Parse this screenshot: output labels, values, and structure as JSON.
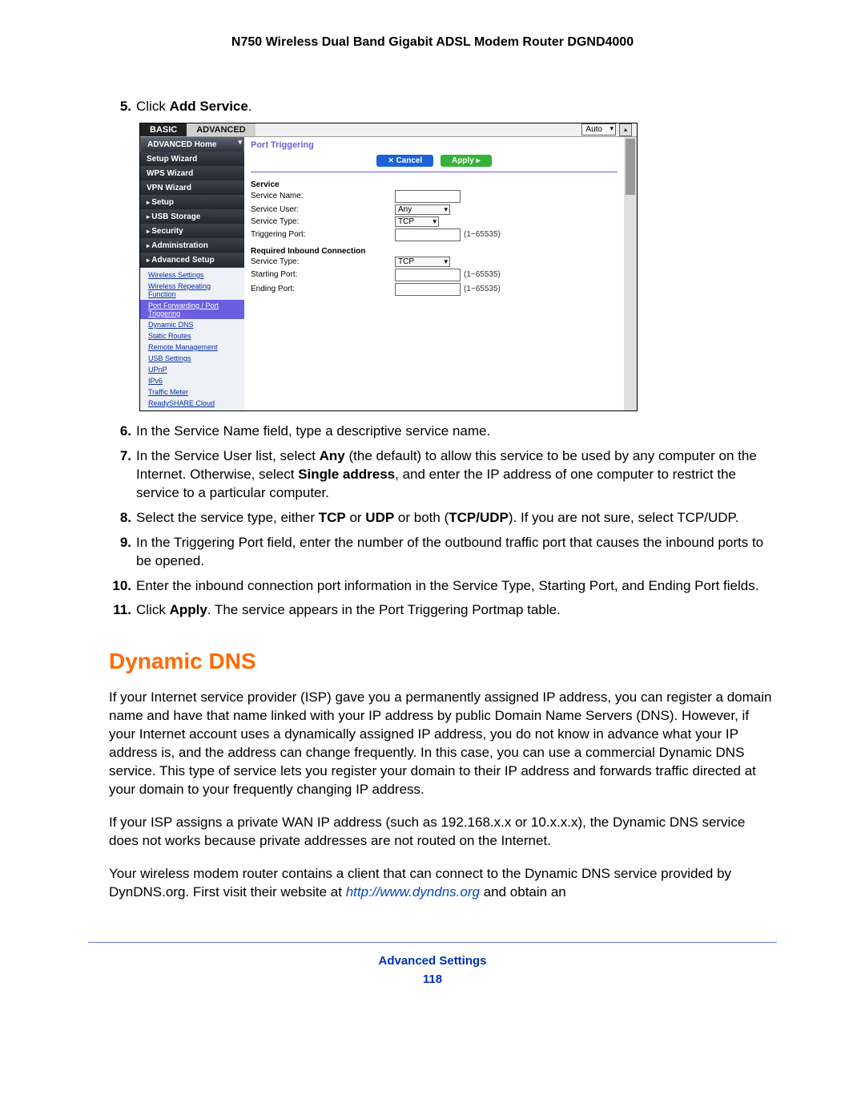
{
  "doc_title": "N750 Wireless Dual Band Gigabit ADSL Modem Router DGND4000",
  "footer_title": "Advanced Settings",
  "page_number": "118",
  "steps": {
    "s5_num": "5.",
    "s5_pre": "Click ",
    "s5_bold": "Add Service",
    "s5_post": ".",
    "s6_num": "6.",
    "s6": "In the Service Name field, type a descriptive service name.",
    "s7_num": "7.",
    "s7_a": "In the Service User list, select ",
    "s7_b": "Any",
    "s7_c": " (the default) to allow this service to be used by any computer on the Internet. Otherwise, select ",
    "s7_d": "Single address",
    "s7_e": ", and enter the IP address of one computer to restrict the service to a particular computer.",
    "s8_num": "8.",
    "s8_a": "Select the service type, either ",
    "s8_b": "TCP",
    "s8_c": " or ",
    "s8_d": "UDP",
    "s8_e": " or both (",
    "s8_f": "TCP/UDP",
    "s8_g": "). If you are not sure, select TCP/UDP.",
    "s9_num": "9.",
    "s9": "In the Triggering Port field, enter the number of the outbound traffic port that causes the inbound ports to be opened.",
    "s10_num": "10.",
    "s10": "Enter the inbound connection port information in the Service Type, Starting Port, and Ending Port fields.",
    "s11_num": "11.",
    "s11_a": "Click ",
    "s11_b": "Apply",
    "s11_c": ". The service appears in the Port Triggering Portmap table."
  },
  "heading": "Dynamic DNS",
  "paragraphs": {
    "p1": "If your Internet service provider (ISP) gave you a permanently assigned IP address, you can register a domain name and have that name linked with your IP address by public Domain Name Servers (DNS). However, if your Internet account uses a dynamically assigned IP address, you do not know in advance what your IP address is, and the address can change frequently. In this case, you can use a commercial Dynamic DNS service. This type of service lets you register your domain to their IP address and forwards traffic directed at your domain to your frequently changing IP address.",
    "p2": "If your ISP assigns a private WAN IP address (such as 192.168.x.x or 10.x.x.x), the Dynamic DNS service does not works because private addresses are not routed on the Internet.",
    "p3_a": "Your wireless modem router contains a client that can connect to the Dynamic DNS service provided by DynDNS.org. First visit their website at ",
    "p3_link": "http://www.dyndns.org",
    "p3_b": " and obtain an"
  },
  "shot": {
    "tab_basic": "BASIC",
    "tab_advanced": "ADVANCED",
    "top_select": "Auto",
    "sidebar": {
      "adv_home": "ADVANCED Home",
      "setup_wizard": "Setup Wizard",
      "wps_wizard": "WPS Wizard",
      "vpn_wizard": "VPN Wizard",
      "setup": "Setup",
      "usb": "USB Storage",
      "security": "Security",
      "admin": "Administration",
      "adv_setup": "Advanced Setup"
    },
    "subs": {
      "wireless": "Wireless Settings",
      "repeat": "Wireless Repeating Function",
      "pf": "Port Forwarding / Port Triggering",
      "ddns": "Dynamic DNS",
      "routes": "Static Routes",
      "remote": "Remote Management",
      "usb": "USB Settings",
      "upnp": "UPnP",
      "ipv6": "IPv6",
      "traffic": "Traffic Meter",
      "rs": "ReadySHARE Cloud"
    },
    "content": {
      "title": "Port Triggering",
      "cancel": "Cancel",
      "apply": "Apply",
      "sec_service": "Service",
      "service_name": "Service Name:",
      "service_user": "Service User:",
      "service_user_val": "Any",
      "service_type": "Service Type:",
      "service_type_val": "TCP",
      "trig_port": "Triggering Port:",
      "range": "(1~65535)",
      "sec_inbound": "Required Inbound Connection",
      "inb_type": "Service Type:",
      "inb_type_val": "TCP",
      "start_port": "Starting Port:",
      "end_port": "Ending Port:"
    }
  }
}
